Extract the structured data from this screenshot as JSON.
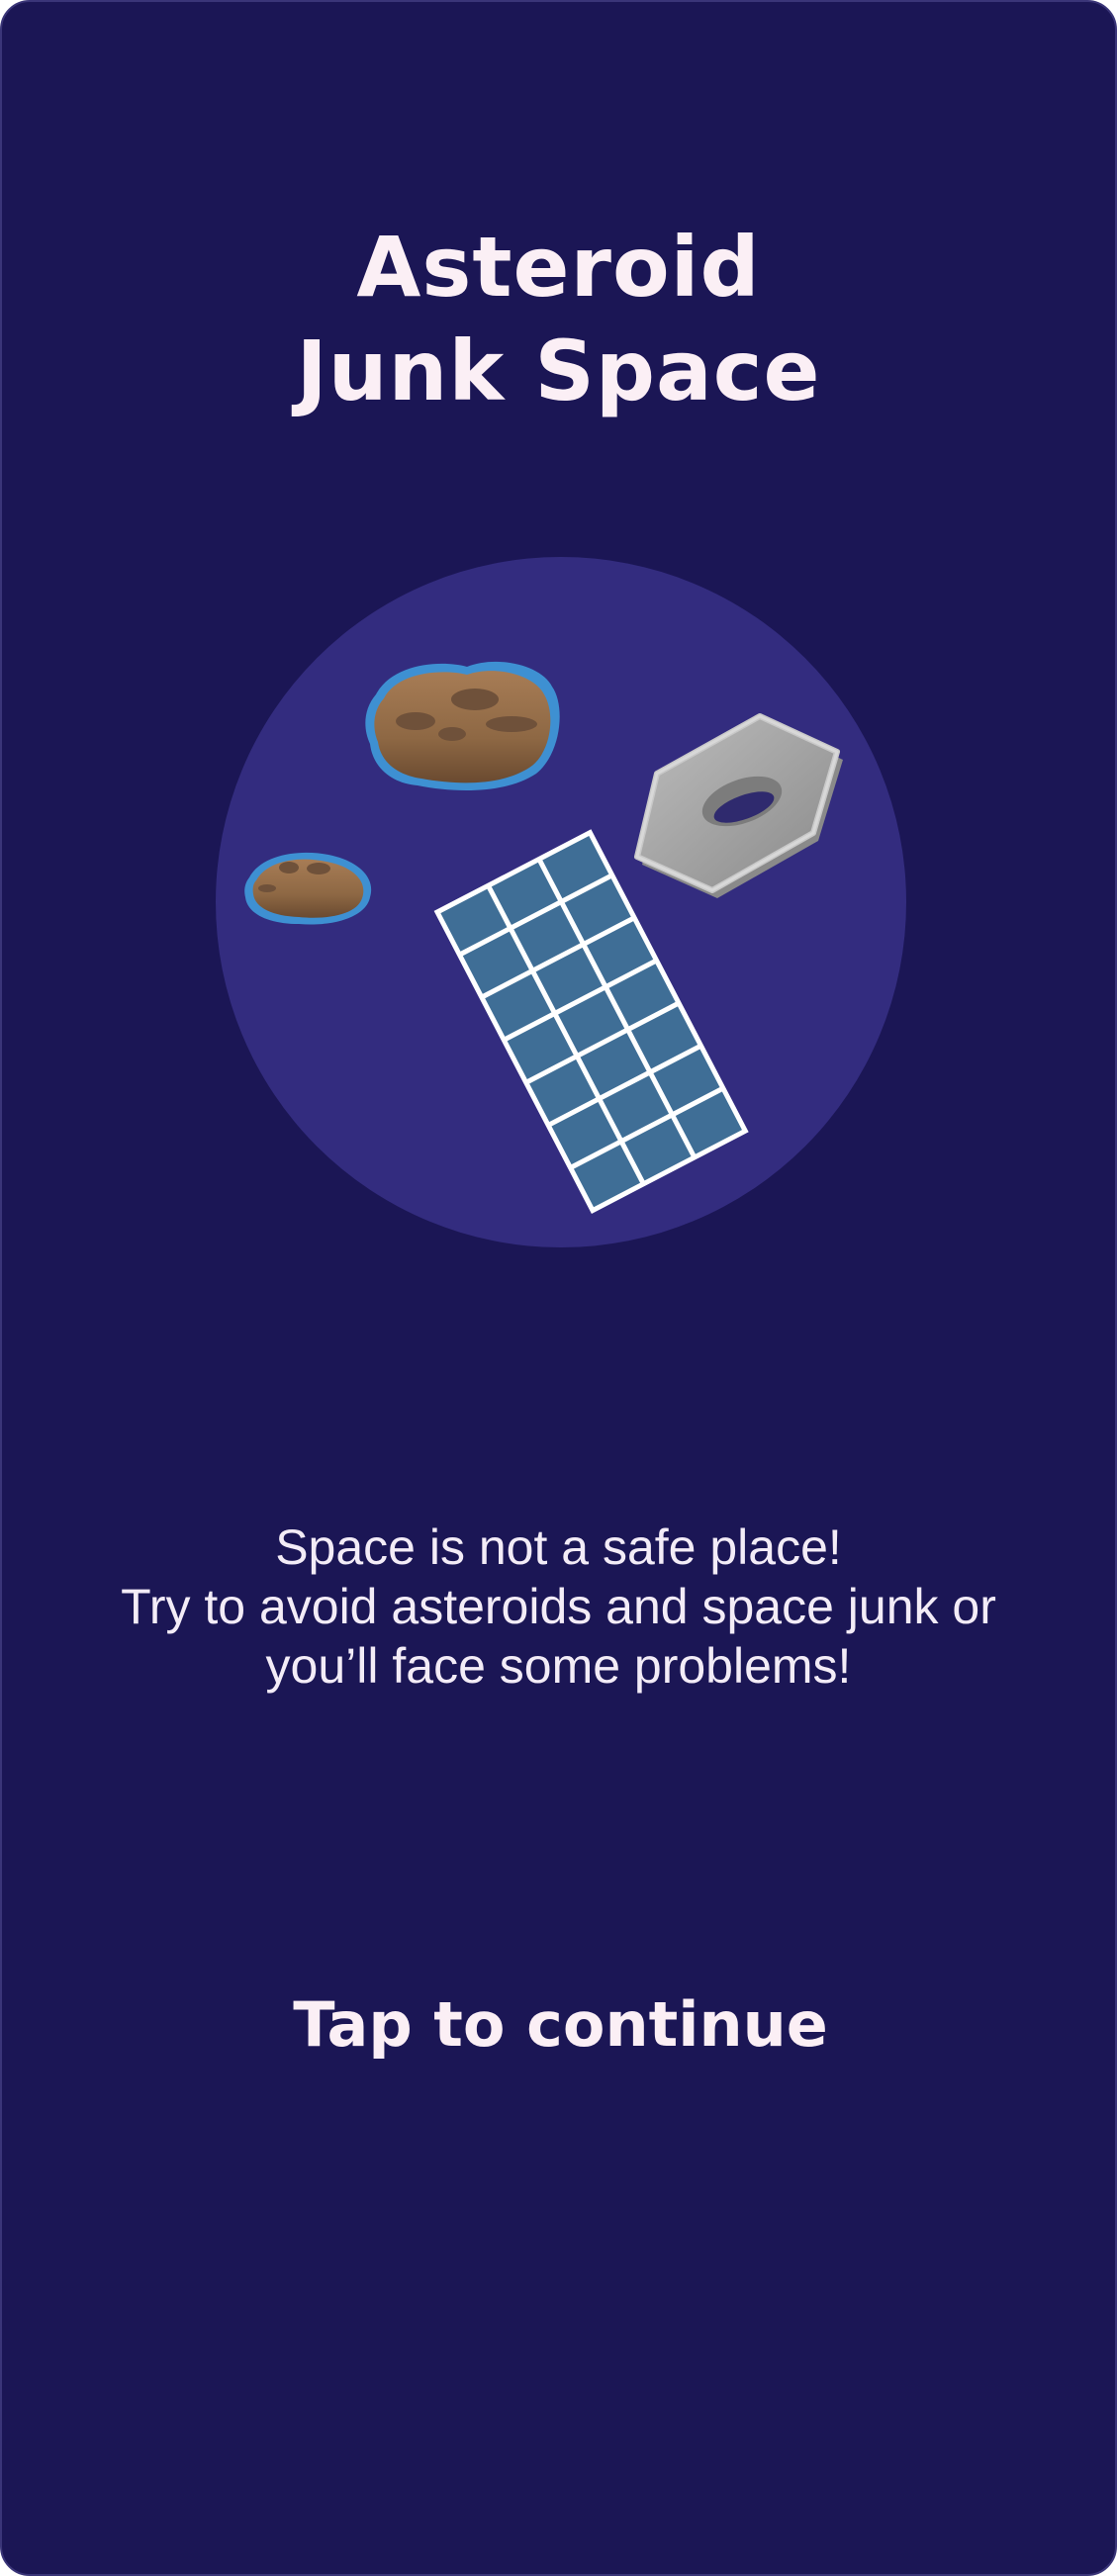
{
  "intro": {
    "title_line_1": "Asteroid",
    "title_line_2": "Junk Space",
    "message_line_1": "Space is not a safe place!",
    "message_line_2": "Try to avoid asteroids and space junk or",
    "message_line_3": "you’ll face some problems!",
    "continue_label": "Tap to continue"
  },
  "illustration": {
    "items": [
      "large-asteroid",
      "small-asteroid",
      "solar-panel",
      "hex-nut"
    ]
  },
  "colors": {
    "background": "#1b1655",
    "circle": "#332c7f",
    "text": "#fbeff5",
    "asteroid": "#a77c55",
    "asteroid_glow": "#3f9bdc",
    "panel_cell": "#3f6e96",
    "nut": "#a3a3a3"
  }
}
